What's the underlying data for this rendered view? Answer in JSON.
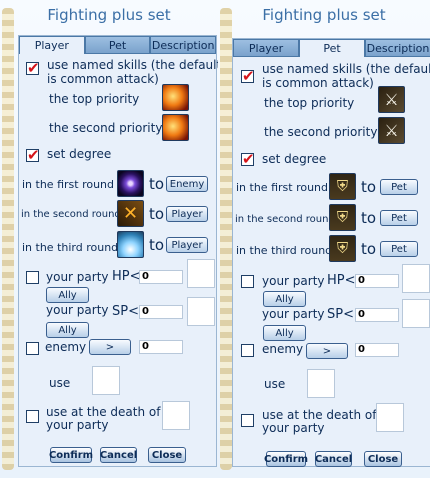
{
  "left": {
    "title": "Fighting plus set",
    "tabs": [
      "Player",
      "Pet",
      "Description"
    ],
    "named_skills_label": [
      "use named skills (the default",
      "is common attack)"
    ],
    "top_priority": "the top priority",
    "second_priority": "the second priority",
    "set_degree": "set degree",
    "round1": "in the first round",
    "round2": "in the second round",
    "round3": "in the third round",
    "to": "to",
    "target1": "Enemy",
    "target2": "Player",
    "target3": "Player",
    "your_party": "your party",
    "hp": "HP<",
    "sp": "SP<",
    "hp_value": "0",
    "sp_value": "0",
    "ally": "Ally",
    "enemy": "enemy",
    "enemy_btn": ">",
    "enemy_value": "0",
    "use": "use",
    "death_label": [
      "use at the death of",
      "your party"
    ],
    "confirm": "Confirm",
    "cancel": "Cancel",
    "close": "Close"
  },
  "right": {
    "title": "Fighting plus set",
    "tabs": [
      "Player",
      "Pet",
      "Description"
    ],
    "named_skills_label": [
      "use named skills (the default",
      "is common attack)"
    ],
    "top_priority": "the top priority",
    "second_priority": "the second priority",
    "set_degree": "set degree",
    "round1": "in the first round",
    "round2": "in the second round",
    "round3": "in the third round",
    "to": "to",
    "target1": "Pet",
    "target2": "Pet",
    "target3": "Pet",
    "your_party": "your party",
    "hp": "HP<",
    "sp": "SP<",
    "hp_value": "0",
    "sp_value": "0",
    "ally": "Ally",
    "enemy": "enemy",
    "enemy_btn": ">",
    "enemy_value": "0",
    "use": "use",
    "death_label": [
      "use at the death of",
      "your party"
    ],
    "confirm": "Confirm",
    "cancel": "Cancel",
    "close": "Close"
  },
  "colors": {
    "title": "#3b6fa6",
    "check": "#d4141a",
    "text": "#0d2c57"
  },
  "icons": {
    "left": [
      "fire-skill-icon",
      "fire-skill-icon",
      "vortex-skill-icon",
      "crossed-swords-icon",
      "healing-light-icon"
    ],
    "right": [
      "sword-skill-icon",
      "sword-skill-icon",
      "pet-shield-icon",
      "pet-shield-icon",
      "pet-shield-icon"
    ]
  }
}
